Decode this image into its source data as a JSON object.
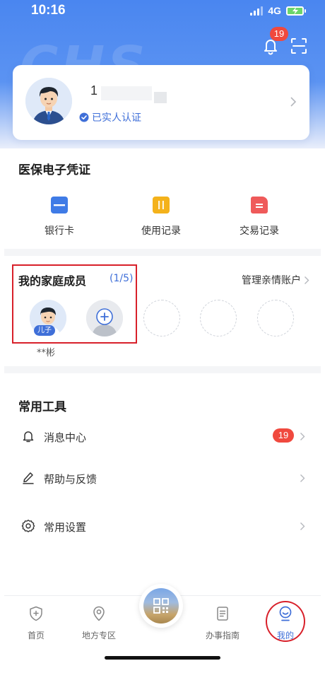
{
  "status_bar": {
    "time": "10:16",
    "network": "4G"
  },
  "header": {
    "watermark": "CHS",
    "notification_badge": "19",
    "bell_icon": "bell-icon",
    "scan_icon": "scan-icon"
  },
  "profile": {
    "name_visible": "1",
    "verified_label": "已实人认证",
    "avatar_icon": "male-avatar-icon"
  },
  "insurance": {
    "title": "医保电子凭证",
    "items": [
      {
        "label": "银行卡",
        "icon": "bank-card-icon",
        "color": "#3f7be6"
      },
      {
        "label": "使用记录",
        "icon": "usage-record-icon",
        "color": "#f4b21b"
      },
      {
        "label": "交易记录",
        "icon": "transaction-record-icon",
        "color": "#ef5a5a"
      }
    ]
  },
  "family": {
    "title": "我的家庭成员",
    "count": "(1/5)",
    "manage_label": "管理亲情账户",
    "members": [
      {
        "relation": "儿子",
        "name": "**彬"
      }
    ]
  },
  "tools": {
    "title": "常用工具",
    "items": [
      {
        "label": "消息中心",
        "icon": "bell-icon",
        "badge": "19"
      },
      {
        "label": "帮助与反馈",
        "icon": "pen-icon"
      },
      {
        "label": "常用设置",
        "icon": "settings-icon"
      }
    ]
  },
  "tabbar": {
    "items": [
      {
        "label": "首页",
        "icon": "shield-plus-icon"
      },
      {
        "label": "地方专区",
        "icon": "location-pin-icon"
      },
      {
        "label": "",
        "icon": "qr-code-icon"
      },
      {
        "label": "办事指南",
        "icon": "document-icon"
      },
      {
        "label": "我的",
        "icon": "smiley-person-icon"
      }
    ],
    "active_index": 4
  },
  "colors": {
    "primary": "#3f6fd8",
    "header_blue": "#4a86f0",
    "badge_red": "#f0493e",
    "highlight_red": "#d8202a"
  }
}
